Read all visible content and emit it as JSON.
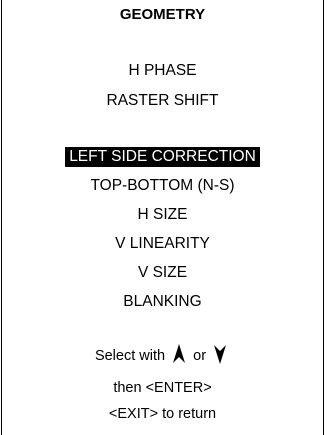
{
  "menu": {
    "title": "GEOMETRY",
    "items_group1": [
      "H PHASE",
      "RASTER SHIFT"
    ],
    "selected": "LEFT SIDE CORRECTION",
    "items_group2": [
      "TOP-BOTTOM (N-S)",
      "H SIZE",
      "V LINEARITY",
      "V SIZE",
      "BLANKING"
    ]
  },
  "footer": {
    "select_prefix": "Select with",
    "select_or": "or",
    "line2": "then <ENTER>",
    "line3": "<EXIT> to return",
    "up_icon": "up-arrow-icon",
    "down_icon": "down-arrow-icon"
  }
}
